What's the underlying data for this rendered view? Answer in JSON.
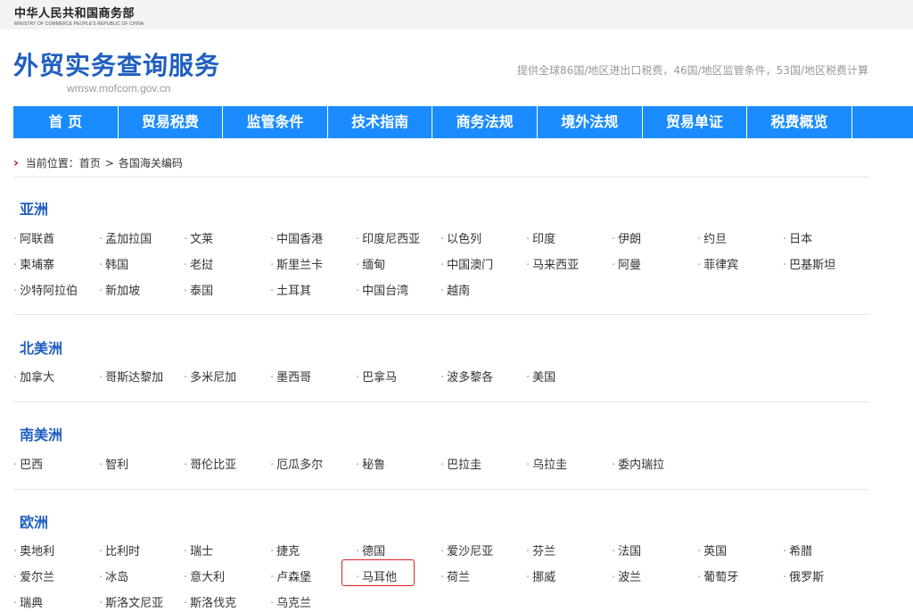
{
  "header": {
    "ministry_cn": "中华人民共和国商务部",
    "ministry_en": "MINISTRY OF COMMERCE PEOPLE'S REPUBLIC OF CHINA",
    "site_title": "外贸实务查询服务",
    "site_url": "wmsw.mofcom.gov.cn",
    "tagline": "提供全球86国/地区进出口税费，46国/地区监管条件，53国/地区税费计算"
  },
  "nav": {
    "items": [
      "首 页",
      "贸易税费",
      "监管条件",
      "技术指南",
      "商务法规",
      "境外法规",
      "贸易单证",
      "税费概览"
    ],
    "color": "#1a8cff"
  },
  "breadcrumb": {
    "prefix": "当前位置：",
    "home": "首页",
    "separator": ">",
    "current": "各国海关编码"
  },
  "regions": [
    {
      "name": "亚洲",
      "countries": [
        "阿联酋",
        "孟加拉国",
        "文莱",
        "中国香港",
        "印度尼西亚",
        "以色列",
        "印度",
        "伊朗",
        "约旦",
        "日本",
        "柬埔寨",
        "韩国",
        "老挝",
        "斯里兰卡",
        "缅甸",
        "中国澳门",
        "马来西亚",
        "阿曼",
        "菲律宾",
        "巴基斯坦",
        "沙特阿拉伯",
        "新加坡",
        "泰国",
        "土耳其",
        "中国台湾",
        "越南"
      ]
    },
    {
      "name": "北美洲",
      "countries": [
        "加拿大",
        "哥斯达黎加",
        "多米尼加",
        "墨西哥",
        "巴拿马",
        "波多黎各",
        "美国"
      ]
    },
    {
      "name": "南美洲",
      "countries": [
        "巴西",
        "智利",
        "哥伦比亚",
        "厄瓜多尔",
        "秘鲁",
        "巴拉圭",
        "乌拉圭",
        "委内瑞拉"
      ]
    },
    {
      "name": "欧洲",
      "countries": [
        "奥地利",
        "比利时",
        "瑞士",
        "捷克",
        "德国",
        "爱沙尼亚",
        "芬兰",
        "法国",
        "英国",
        "希腊",
        "爱尔兰",
        "冰岛",
        "意大利",
        "卢森堡",
        "马耳他",
        "荷兰",
        "挪威",
        "波兰",
        "葡萄牙",
        "俄罗斯",
        "瑞典",
        "斯洛文尼亚",
        "斯洛伐克",
        "乌克兰"
      ]
    }
  ],
  "highlighted_country": "马耳他",
  "colors": {
    "title_blue": "#1f5fbf",
    "nav_blue": "#1a8cff",
    "highlight_red": "#e02020",
    "breadcrumb_arrow": "#d0021b"
  }
}
